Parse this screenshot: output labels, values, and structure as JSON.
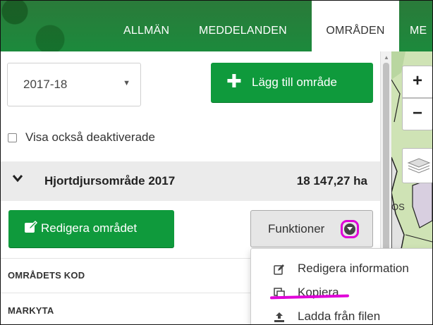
{
  "nav": {
    "tabs": [
      {
        "label": "ALLMÄN"
      },
      {
        "label": "MEDDELANDEN"
      },
      {
        "label": "OMRÅDEN"
      },
      {
        "label": "ME"
      }
    ]
  },
  "panel": {
    "season_select": {
      "value": "2017-18"
    },
    "add_area_button": {
      "label": "Lägg till område",
      "icon": "plus-icon"
    },
    "show_deactivated": {
      "label": "Visa också deaktiverade",
      "checked": false
    },
    "area": {
      "name": "Hjortdjursområde 2017",
      "size": "18 147,27 ha"
    },
    "edit_area_button": {
      "label": "Redigera området",
      "icon": "edit-icon"
    },
    "functions_button": {
      "label": "Funktioner"
    },
    "fields": [
      {
        "label": "OMRÅDETS KOD"
      },
      {
        "label": "MARKYTA"
      }
    ]
  },
  "functions_menu": {
    "items": [
      {
        "label": "Redigera information",
        "icon": "edit-icon"
      },
      {
        "label": "Kopiera",
        "icon": "copy-icon"
      },
      {
        "label": "Ladda från filen",
        "icon": "upload-icon"
      }
    ]
  },
  "map": {
    "zoom_in": "+",
    "zoom_out": "−",
    "partial_label": "OS"
  },
  "colors": {
    "primary_green": "#0f9a3c",
    "nav_green": "#1f8a3a",
    "highlight_magenta": "#e000d8"
  }
}
